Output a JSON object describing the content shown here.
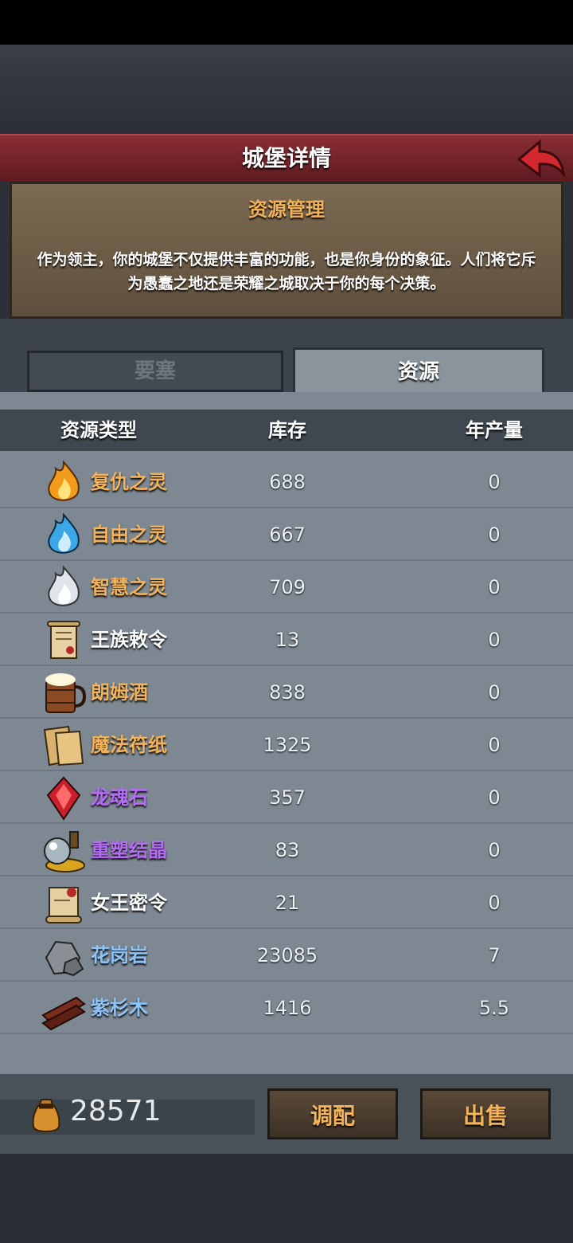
{
  "title": "城堡详情",
  "panel": {
    "section_title": "资源管理",
    "description": "作为领主，你的城堡不仅提供丰富的功能，也是你身份的象征。人们将它斥为愚蠢之地还是荣耀之城取决于你的每个决策。"
  },
  "tabs": [
    {
      "label": "要塞",
      "active": false
    },
    {
      "label": "资源",
      "active": true
    }
  ],
  "table": {
    "headers": {
      "type": "资源类型",
      "stock": "库存",
      "production": "年产量"
    },
    "rows": [
      {
        "name": "复仇之灵",
        "stock": "688",
        "production": "0",
        "color": "#f3b35a",
        "icon": "flame-orange-icon"
      },
      {
        "name": "自由之灵",
        "stock": "667",
        "production": "0",
        "color": "#f3b35a",
        "icon": "flame-blue-icon"
      },
      {
        "name": "智慧之灵",
        "stock": "709",
        "production": "0",
        "color": "#f3b35a",
        "icon": "flame-white-icon"
      },
      {
        "name": "王族敕令",
        "stock": "13",
        "production": "0",
        "color": "#ffffff",
        "icon": "scroll-icon"
      },
      {
        "name": "朗姆酒",
        "stock": "838",
        "production": "0",
        "color": "#f3b35a",
        "icon": "beer-mug-icon"
      },
      {
        "name": "魔法符纸",
        "stock": "1325",
        "production": "0",
        "color": "#f3b35a",
        "icon": "paper-icon"
      },
      {
        "name": "龙魂石",
        "stock": "357",
        "production": "0",
        "color": "#b66df5",
        "icon": "red-gem-icon"
      },
      {
        "name": "重塑结晶",
        "stock": "83",
        "production": "0",
        "color": "#b66df5",
        "icon": "crystal-orb-icon"
      },
      {
        "name": "女王密令",
        "stock": "21",
        "production": "0",
        "color": "#ffffff",
        "icon": "sealed-letter-icon"
      },
      {
        "name": "花岗岩",
        "stock": "23085",
        "production": "7",
        "color": "#8ec3f7",
        "icon": "granite-icon"
      },
      {
        "name": "紫杉木",
        "stock": "1416",
        "production": "5.5",
        "color": "#8ec3f7",
        "icon": "wood-planks-icon"
      }
    ]
  },
  "bottom": {
    "gold_amount": "28571",
    "adjust_label": "调配",
    "sell_label": "出售"
  },
  "colors": {
    "title_bar": "#7a252b",
    "accent_text": "#f3b35a",
    "rare_purple": "#b66df5",
    "common_blue": "#8ec3f7"
  }
}
